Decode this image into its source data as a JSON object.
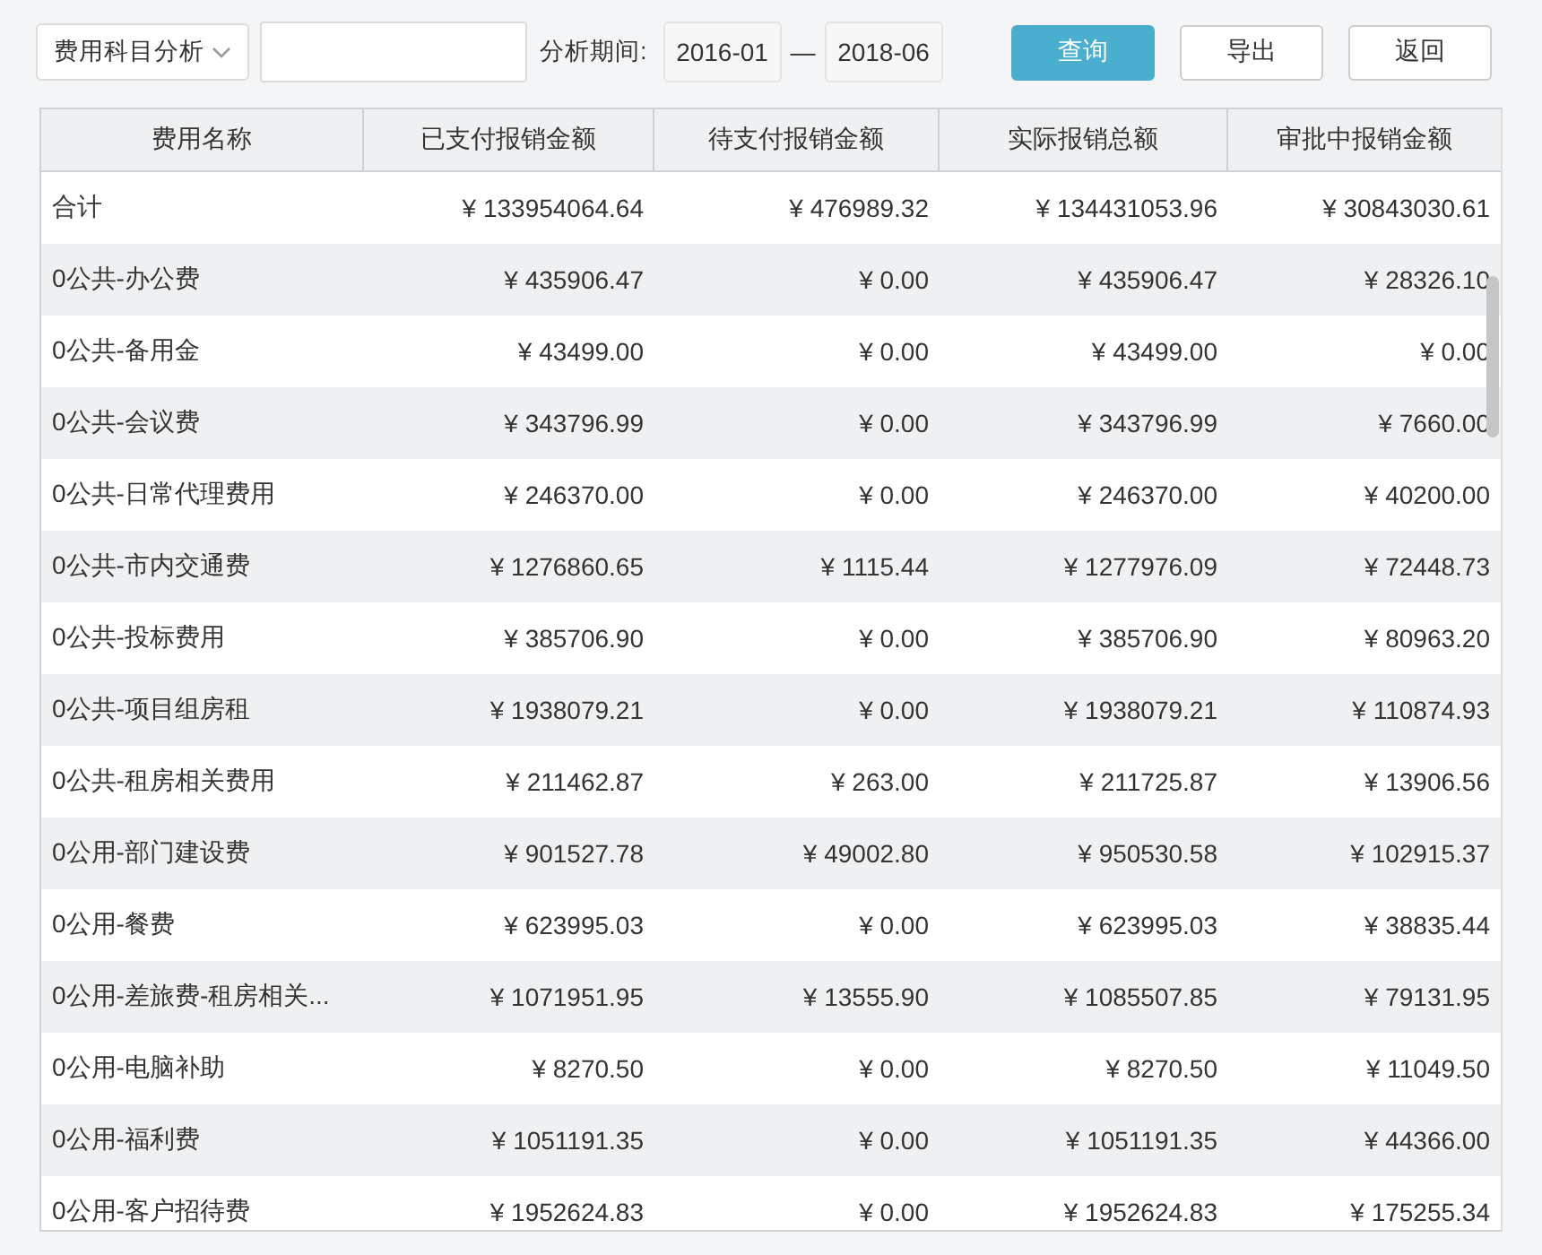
{
  "toolbar": {
    "category_select": {
      "value": "费用科目分析"
    },
    "period_label": "分析期间:",
    "period_start": "2016-01",
    "period_separator": "—",
    "period_end": "2018-06",
    "buttons": [
      {
        "label": "查询",
        "kind": "primary"
      },
      {
        "label": "导出",
        "kind": "default"
      },
      {
        "label": "返回",
        "kind": "default"
      }
    ]
  },
  "table": {
    "columns": [
      "费用名称",
      "已支付报销金额",
      "待支付报销金额",
      "实际报销总额",
      "审批中报销金额"
    ],
    "rows": [
      {
        "cells": [
          "合计",
          "¥ 133954064.64",
          "¥ 476989.32",
          "¥ 134431053.96",
          "¥ 30843030.61"
        ]
      },
      {
        "cells": [
          "0公共-办公费",
          "¥ 435906.47",
          "¥ 0.00",
          "¥ 435906.47",
          "¥ 28326.10"
        ]
      },
      {
        "cells": [
          "0公共-备用金",
          "¥ 43499.00",
          "¥ 0.00",
          "¥ 43499.00",
          "¥ 0.00"
        ]
      },
      {
        "cells": [
          "0公共-会议费",
          "¥ 343796.99",
          "¥ 0.00",
          "¥ 343796.99",
          "¥ 7660.00"
        ]
      },
      {
        "cells": [
          "0公共-日常代理费用",
          "¥ 246370.00",
          "¥ 0.00",
          "¥ 246370.00",
          "¥ 40200.00"
        ]
      },
      {
        "cells": [
          "0公共-市内交通费",
          "¥ 1276860.65",
          "¥ 1115.44",
          "¥ 1277976.09",
          "¥ 72448.73"
        ]
      },
      {
        "cells": [
          "0公共-投标费用",
          "¥ 385706.90",
          "¥ 0.00",
          "¥ 385706.90",
          "¥ 80963.20"
        ]
      },
      {
        "cells": [
          "0公共-项目组房租",
          "¥ 1938079.21",
          "¥ 0.00",
          "¥ 1938079.21",
          "¥ 110874.93"
        ]
      },
      {
        "cells": [
          "0公共-租房相关费用",
          "¥ 211462.87",
          "¥ 263.00",
          "¥ 211725.87",
          "¥ 13906.56"
        ]
      },
      {
        "cells": [
          "0公用-部门建设费",
          "¥ 901527.78",
          "¥ 49002.80",
          "¥ 950530.58",
          "¥ 102915.37"
        ]
      },
      {
        "cells": [
          "0公用-餐费",
          "¥ 623995.03",
          "¥ 0.00",
          "¥ 623995.03",
          "¥ 38835.44"
        ]
      },
      {
        "cells": [
          "0公用-差旅费-租房相关...",
          "¥ 1071951.95",
          "¥ 13555.90",
          "¥ 1085507.85",
          "¥ 79131.95"
        ]
      },
      {
        "cells": [
          "0公用-电脑补助",
          "¥ 8270.50",
          "¥ 0.00",
          "¥ 8270.50",
          "¥ 11049.50"
        ]
      },
      {
        "cells": [
          "0公用-福利费",
          "¥ 1051191.35",
          "¥ 0.00",
          "¥ 1051191.35",
          "¥ 44366.00"
        ]
      },
      {
        "cells": [
          "0公用-客户招待费",
          "¥ 1952624.83",
          "¥ 0.00",
          "¥ 1952624.83",
          "¥ 175255.34"
        ]
      }
    ]
  }
}
